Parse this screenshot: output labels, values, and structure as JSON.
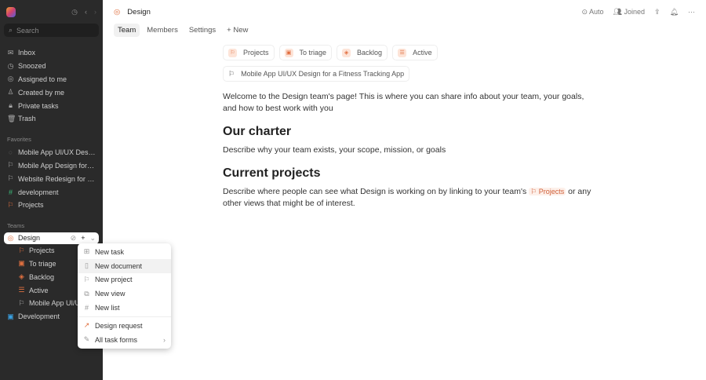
{
  "sidebar": {
    "search_placeholder": "Search",
    "nav": [
      {
        "icon": "inbox-icon",
        "g": "✉",
        "label": "Inbox"
      },
      {
        "icon": "clock-icon",
        "g": "◷",
        "label": "Snoozed"
      },
      {
        "icon": "target-icon",
        "g": "◎",
        "label": "Assigned to me"
      },
      {
        "icon": "user-icon",
        "g": "♙",
        "label": "Created by me"
      },
      {
        "icon": "lock-icon",
        "g": "🔒︎",
        "label": "Private tasks"
      },
      {
        "icon": "trash-icon",
        "g": "🗑︎",
        "label": "Trash"
      }
    ],
    "favorites_label": "Favorites",
    "favorites": [
      {
        "label": "Mobile App UI/UX Design for a Fitness Tracking App",
        "g": "○",
        "c": "#555"
      },
      {
        "label": "Mobile App Design for a Fitness App",
        "g": "⚐",
        "c": "#aaa"
      },
      {
        "label": "Website Redesign for a Company",
        "g": "⚐",
        "c": "#aaa"
      },
      {
        "label": "development",
        "g": "#",
        "c": "#3cb878"
      },
      {
        "label": "Projects",
        "g": "⚐",
        "c": "#e07040"
      }
    ],
    "teams_label": "Teams",
    "team": "Design",
    "team_items": [
      {
        "label": "Projects",
        "g": "⚐",
        "c": "#e07040"
      },
      {
        "label": "To triage",
        "g": "▣",
        "c": "#e07040"
      },
      {
        "label": "Backlog",
        "g": "◈",
        "c": "#e07040"
      },
      {
        "label": "Active",
        "g": "☰",
        "c": "#e07040"
      },
      {
        "label": "Mobile App UI/UX Design",
        "g": "⚐",
        "c": "#aaa"
      }
    ],
    "dev_team": "Development"
  },
  "header": {
    "title": "Design",
    "auto": "Auto",
    "joined": "Joined"
  },
  "tabs": [
    "Team",
    "Members",
    "Settings",
    "+ New"
  ],
  "chips": [
    "Projects",
    "To triage",
    "Backlog",
    "Active"
  ],
  "project_chip": "Mobile App UI/UX Design for a Fitness Tracking App",
  "doc": {
    "intro": "Welcome to the Design team's page! This is where you can share info about your team, your goals, and how to best work with you",
    "h1": "Our charter",
    "p1": "Describe why your team exists, your scope, mission, or goals",
    "h2": "Current projects",
    "p2a": "Describe where people can see what Design is working on by linking to your team's",
    "p2link": "⚐ Projects",
    "p2b": "or any other views that might be of interest."
  },
  "menu": [
    {
      "g": "⊞",
      "label": "New task"
    },
    {
      "g": "▯",
      "label": "New document"
    },
    {
      "g": "⚐",
      "label": "New project"
    },
    {
      "g": "⧉",
      "label": "New view"
    },
    {
      "g": "#",
      "label": "New list"
    }
  ],
  "menu2": [
    {
      "g": "↗",
      "label": "Design request"
    },
    {
      "g": "✎",
      "label": "All task forms"
    }
  ]
}
